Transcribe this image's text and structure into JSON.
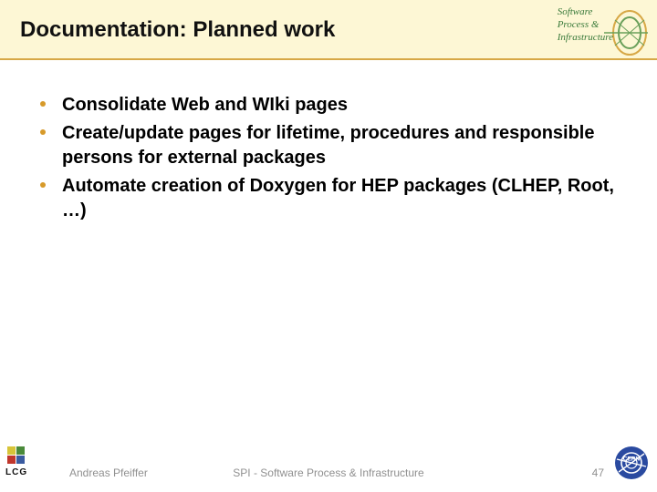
{
  "header": {
    "title": "Documentation: Planned work",
    "logo_text": {
      "l1": "Software",
      "l2": "Process &",
      "l3": "Infrastructure"
    }
  },
  "bullets": [
    "Consolidate Web and WIki pages",
    "Create/update pages for lifetime, procedures and responsible persons for external packages",
    "Automate creation of Doxygen for HEP packages (CLHEP, Root, …)"
  ],
  "footer": {
    "lcg": "LCG",
    "author": "Andreas Pfeiffer",
    "center": "SPI - Software Process & Infrastructure",
    "page": "47",
    "cern": "CERN"
  }
}
